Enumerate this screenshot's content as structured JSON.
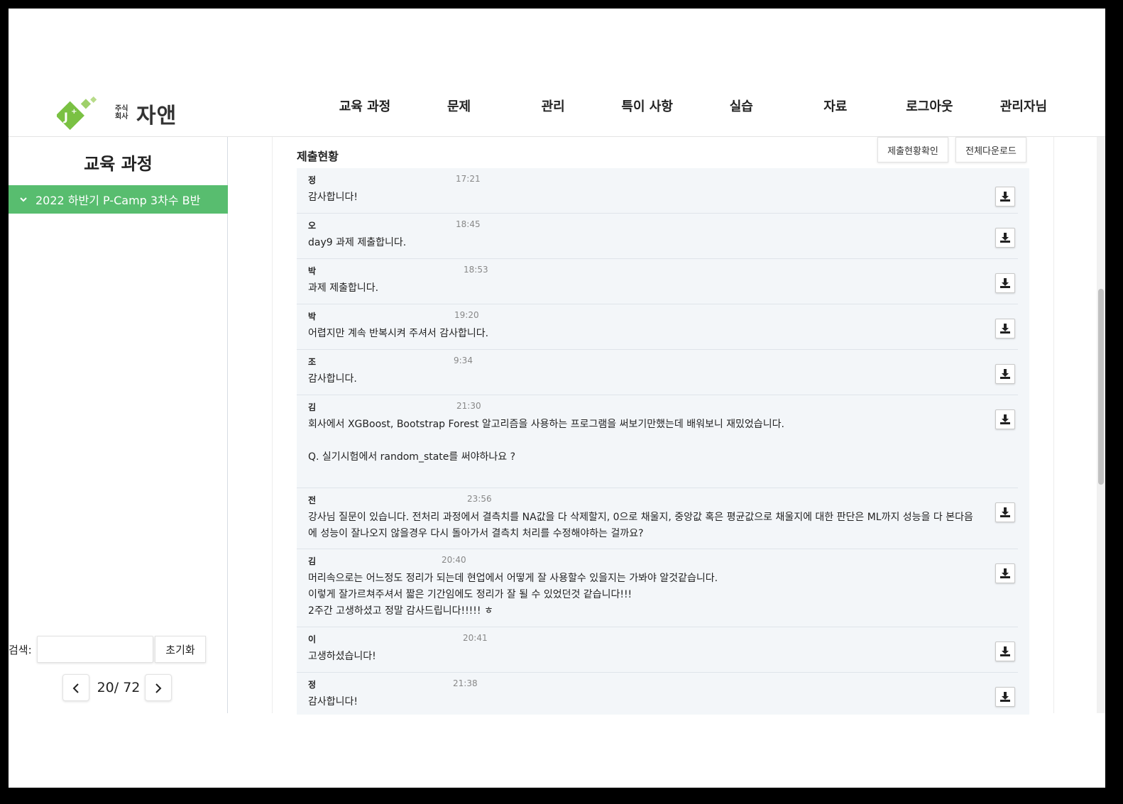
{
  "brand": {
    "small_text_line1": "주식",
    "small_text_line2": "회사",
    "name": "자앤",
    "colors": {
      "green": "#58bd6f",
      "logo_green": "#7ac143"
    }
  },
  "nav": [
    {
      "label": "교육 과정"
    },
    {
      "label": "문제"
    },
    {
      "label": "관리"
    },
    {
      "label": "특이 사항"
    },
    {
      "label": "실습"
    },
    {
      "label": "자료"
    },
    {
      "label": "로그아웃"
    },
    {
      "label": "관리자님"
    }
  ],
  "sidebar": {
    "title": "교육 과정",
    "course": "2022 하반기 P-Camp 3차수 B반",
    "search_label": "검색:",
    "search_value": "",
    "reset_label": "초기화",
    "pager_text": "20/ 72"
  },
  "main": {
    "title": "제출현황",
    "btn_status": "제출현황확인",
    "btn_download_all": "전체다운로드"
  },
  "submissions": [
    {
      "name": "정",
      "time": "17:21",
      "message": "감사합니다!"
    },
    {
      "name": "오",
      "time": "18:45",
      "message": "day9 과제 제출합니다."
    },
    {
      "name": "박",
      "time": "18:53",
      "message": "과제 제출합니다."
    },
    {
      "name": "박",
      "time": "19:20",
      "message": "어렵지만 계속 반복시켜 주셔서 감사합니다."
    },
    {
      "name": "조",
      "time": "9:34",
      "message": "감사합니다."
    },
    {
      "name": "김",
      "time": "21:30",
      "message": "회사에서 XGBoost, Bootstrap Forest 알고리즘을 사용하는 프로그램을 써보기만했는데 배워보니 재밌었습니다.\n\nQ. 실기시험에서 random_state를 써야하나요 ?"
    },
    {
      "name": "전",
      "time": "23:56",
      "message": "강사님 질문이 있습니다. 전처리 과정에서 결측치를 NA값을 다 삭제할지, 0으로 채울지, 중앙값 혹은 평균값으로 채울지에 대한 판단은 ML까지 성능을 다 본다음에 성능이 잘나오지 않을경우 다시 돌아가서 결측치 처리를 수정해야하는 걸까요?"
    },
    {
      "name": "김",
      "time": "20:40",
      "message": "머리속으로는 어느정도 정리가 되는데 현업에서 어떻게 잘 사용할수 있을지는 가봐야 알것같습니다.\n이렇게 잘가르쳐주셔서 짧은 기간임에도 정리가 잘 될 수 있었던것 같습니다!!!\n2주간 고생하셨고 정말 감사드립니다!!!!! ㅎ"
    },
    {
      "name": "이",
      "time": "20:41",
      "message": "고생하셨습니다!"
    },
    {
      "name": "정",
      "time": "21:38",
      "message": "감사합니다!"
    }
  ]
}
